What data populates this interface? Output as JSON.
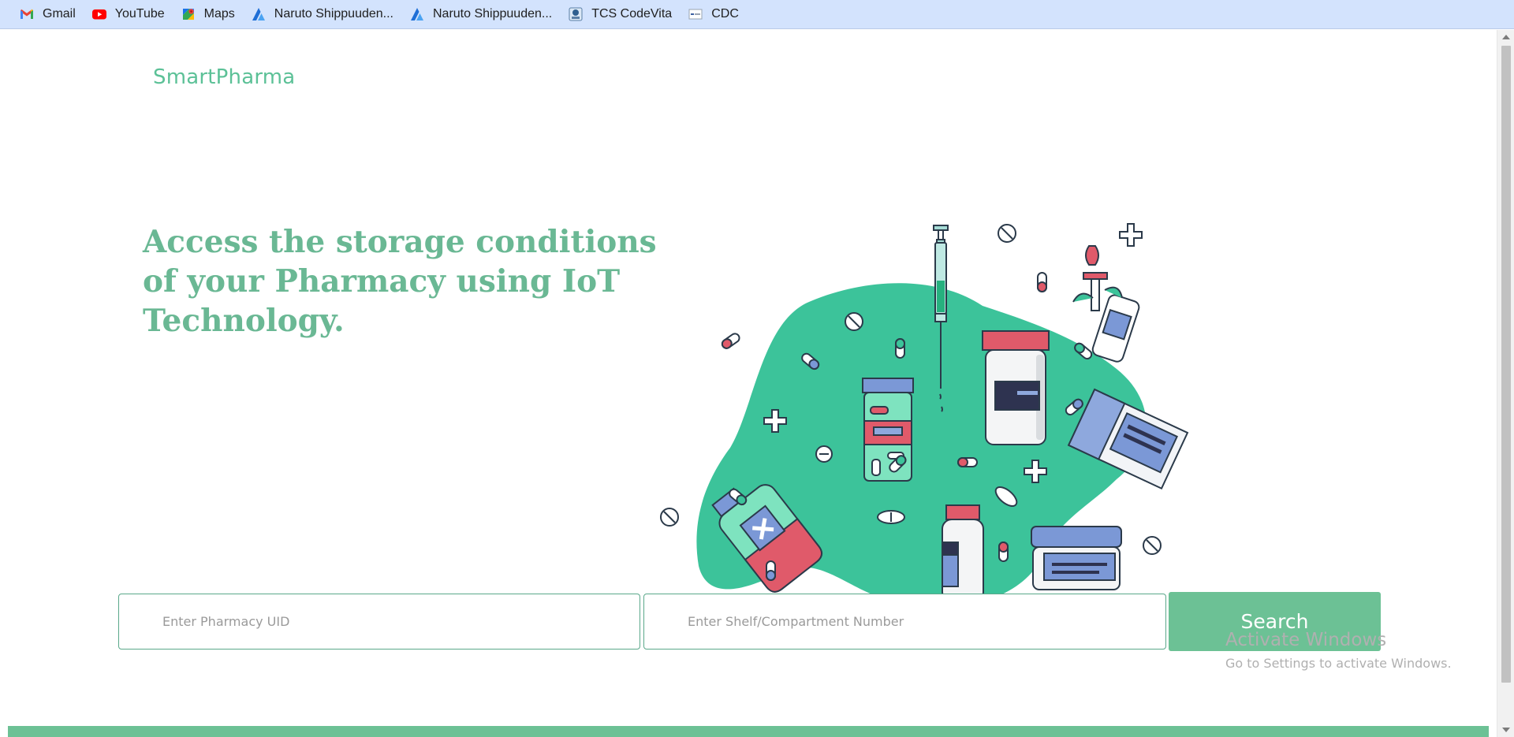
{
  "bookmarks": [
    {
      "label": "Gmail",
      "icon": "gmail-icon"
    },
    {
      "label": "YouTube",
      "icon": "youtube-icon"
    },
    {
      "label": "Maps",
      "icon": "maps-icon"
    },
    {
      "label": "Naruto Shippuuden...",
      "icon": "anime-site-icon"
    },
    {
      "label": "Naruto Shippuuden...",
      "icon": "anime-site-icon"
    },
    {
      "label": "TCS CodeVita",
      "icon": "codevita-icon"
    },
    {
      "label": "CDC",
      "icon": "cdc-icon"
    }
  ],
  "brand": "SmartPharma",
  "headline": "Access the storage conditions of your Pharmacy using IoT Technology.",
  "form": {
    "uid_placeholder": "Enter Pharmacy UID",
    "shelf_placeholder": "Enter Shelf/Compartment Number",
    "uid_value": "",
    "shelf_value": "",
    "search_label": "Search"
  },
  "watermark": {
    "title": "Activate Windows",
    "subtitle": "Go to Settings to activate Windows."
  },
  "colors": {
    "brand": "#5cc197",
    "headline": "#6ab894",
    "button": "#6cc195",
    "blob": "#3cc39a",
    "bookmark_bar": "#d3e3fd"
  },
  "hero_illustration": "medicine-bottles-illustration"
}
